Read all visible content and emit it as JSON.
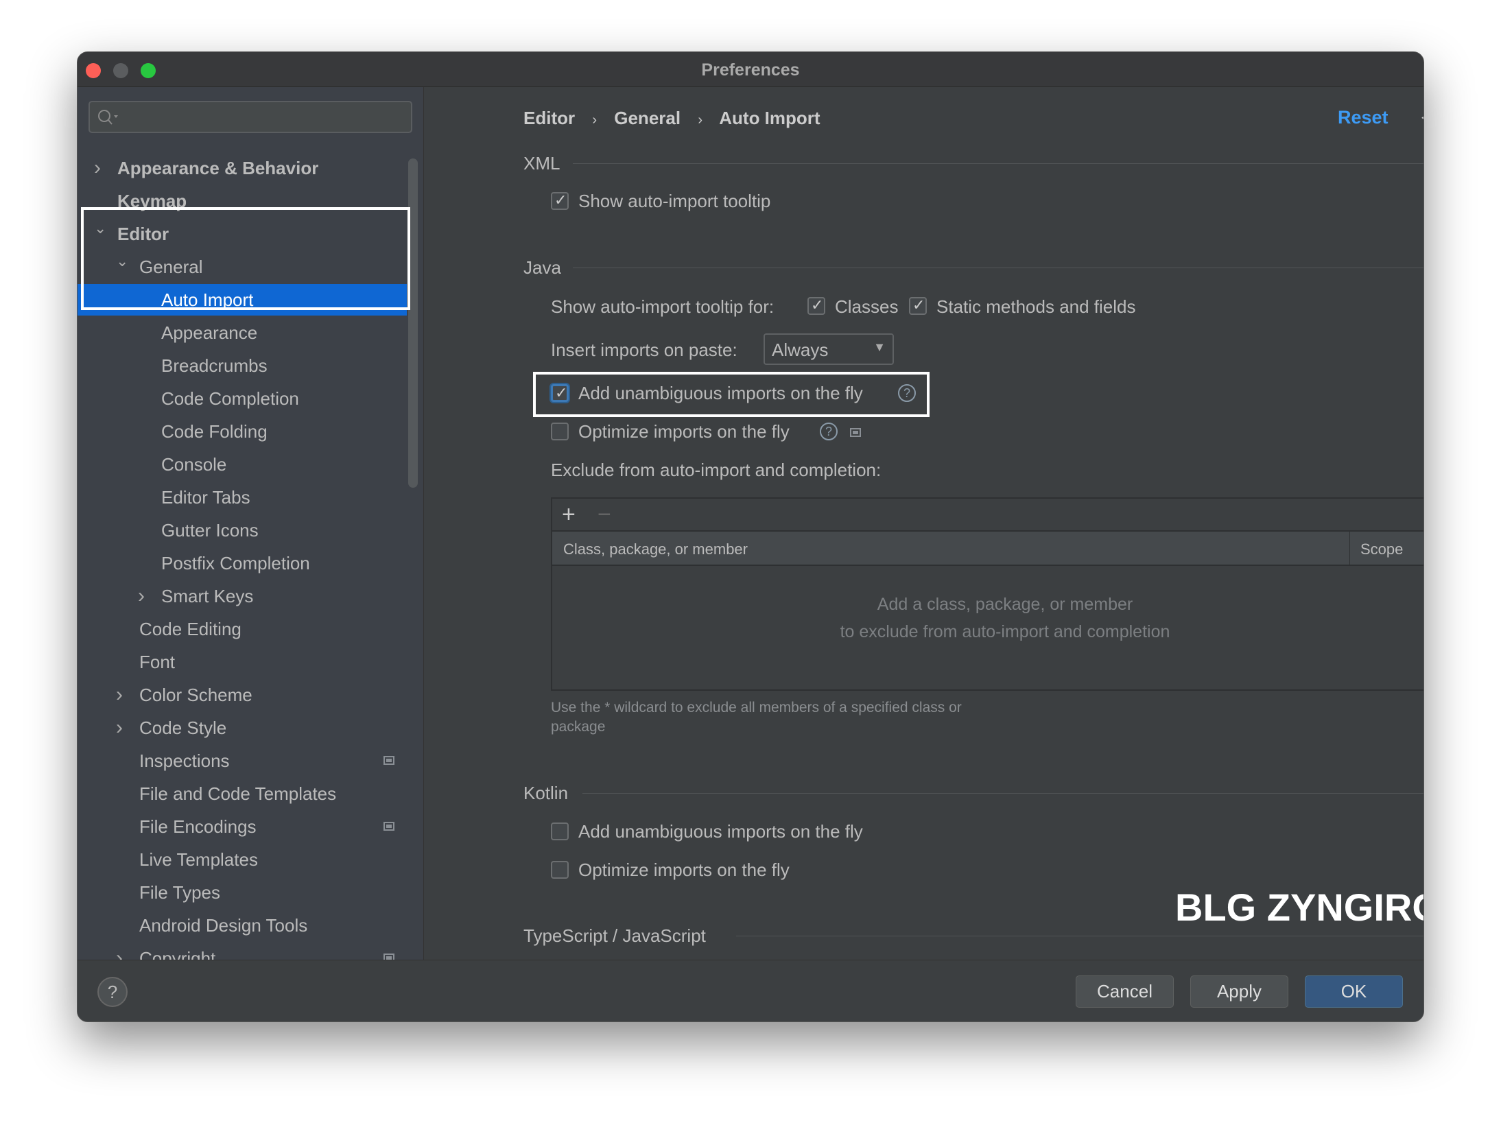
{
  "window": {
    "title": "Preferences"
  },
  "search": {
    "placeholder": ""
  },
  "sidebar": {
    "items": [
      {
        "label": "Appearance & Behavior",
        "level": 0,
        "chevron": "right",
        "bold": true
      },
      {
        "label": "Keymap",
        "level": 0,
        "chevron": "",
        "bold": true
      },
      {
        "label": "Editor",
        "level": 0,
        "chevron": "down",
        "bold": true
      },
      {
        "label": "General",
        "level": 1,
        "chevron": "down"
      },
      {
        "label": "Auto Import",
        "level": 2,
        "chevron": "",
        "selected": true
      },
      {
        "label": "Appearance",
        "level": 2,
        "chevron": ""
      },
      {
        "label": "Breadcrumbs",
        "level": 2,
        "chevron": ""
      },
      {
        "label": "Code Completion",
        "level": 2,
        "chevron": ""
      },
      {
        "label": "Code Folding",
        "level": 2,
        "chevron": ""
      },
      {
        "label": "Console",
        "level": 2,
        "chevron": ""
      },
      {
        "label": "Editor Tabs",
        "level": 2,
        "chevron": ""
      },
      {
        "label": "Gutter Icons",
        "level": 2,
        "chevron": ""
      },
      {
        "label": "Postfix Completion",
        "level": 2,
        "chevron": ""
      },
      {
        "label": "Smart Keys",
        "level": 2,
        "chevron": "right"
      },
      {
        "label": "Code Editing",
        "level": 1,
        "chevron": ""
      },
      {
        "label": "Font",
        "level": 1,
        "chevron": ""
      },
      {
        "label": "Color Scheme",
        "level": 1,
        "chevron": "right"
      },
      {
        "label": "Code Style",
        "level": 1,
        "chevron": "right"
      },
      {
        "label": "Inspections",
        "level": 1,
        "chevron": "",
        "modified": true
      },
      {
        "label": "File and Code Templates",
        "level": 1,
        "chevron": ""
      },
      {
        "label": "File Encodings",
        "level": 1,
        "chevron": "",
        "modified": true
      },
      {
        "label": "Live Templates",
        "level": 1,
        "chevron": ""
      },
      {
        "label": "File Types",
        "level": 1,
        "chevron": ""
      },
      {
        "label": "Android Design Tools",
        "level": 1,
        "chevron": ""
      },
      {
        "label": "Copyright",
        "level": 1,
        "chevron": "right",
        "modified": true
      }
    ]
  },
  "breadcrumb": [
    "Editor",
    "General",
    "Auto Import"
  ],
  "header": {
    "reset": "Reset"
  },
  "xml": {
    "title": "XML",
    "show_tooltip": {
      "label": "Show auto-import tooltip",
      "checked": true
    }
  },
  "java": {
    "title": "Java",
    "tooltip_for": "Show auto-import tooltip for:",
    "classes": {
      "label": "Classes",
      "checked": true
    },
    "static": {
      "label": "Static methods and fields",
      "checked": true
    },
    "insert_label": "Insert imports on paste:",
    "insert_value": "Always",
    "add_unambiguous": {
      "label": "Add unambiguous imports on the fly",
      "checked": true
    },
    "optimize": {
      "label": "Optimize imports on the fly",
      "checked": false
    },
    "exclude_label": "Exclude from auto-import and completion:",
    "table": {
      "columns": [
        "Class, package, or member",
        "Scope"
      ],
      "empty_line1": "Add a class, package, or member",
      "empty_line2": "to exclude from auto-import and completion"
    },
    "hint_line1": "Use the * wildcard to exclude all members of a specified class or",
    "hint_line2": "package"
  },
  "kotlin": {
    "title": "Kotlin",
    "add_unambiguous": {
      "label": "Add unambiguous imports on the fly",
      "checked": false
    },
    "optimize": {
      "label": "Optimize imports on the fly",
      "checked": false
    }
  },
  "typescript": {
    "title": "TypeScript / JavaScript"
  },
  "watermark": "BLG ZYNGIROK",
  "footer": {
    "help": "?",
    "cancel": "Cancel",
    "apply": "Apply",
    "ok": "OK"
  },
  "colors": {
    "accent": "#0f67d3",
    "link": "#3d9bf5",
    "close": "#fe5f57",
    "minimize": "#5b5d5f",
    "maximize": "#28c840"
  }
}
